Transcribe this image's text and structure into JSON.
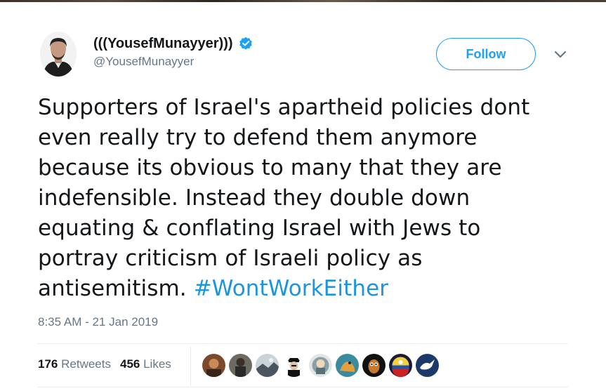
{
  "tweet": {
    "author": {
      "display_name": "(((YousefMunayyer)))",
      "handle": "@YousefMunayyer",
      "verified_icon": "verified-badge-icon",
      "verified_color": "#1da1f2"
    },
    "follow_label": "Follow",
    "more_icon": "chevron-down-icon",
    "text_lines": [
      "Supporters of Israel's apartheid policies dont",
      "even really try to defend them anymore",
      "because its obvious to many that they are",
      "indefensible. Instead they double down",
      "equating & conflating Israel with Jews to",
      "portray criticism of Israeli policy as",
      "antisemitism."
    ],
    "hashtag": "#WontWorkEither",
    "timestamp": "8:35 AM - 21 Jan 2019",
    "stats": {
      "retweets_count": "176",
      "retweets_label": "Retweets",
      "likes_count": "456",
      "likes_label": "Likes"
    },
    "liker_avatar_count": 9
  },
  "colors": {
    "accent": "#1da1f2",
    "hashtag": "#1b95e0",
    "secondary_text": "#657786",
    "primary_text": "#14171a",
    "divider": "#e6ecf0"
  }
}
